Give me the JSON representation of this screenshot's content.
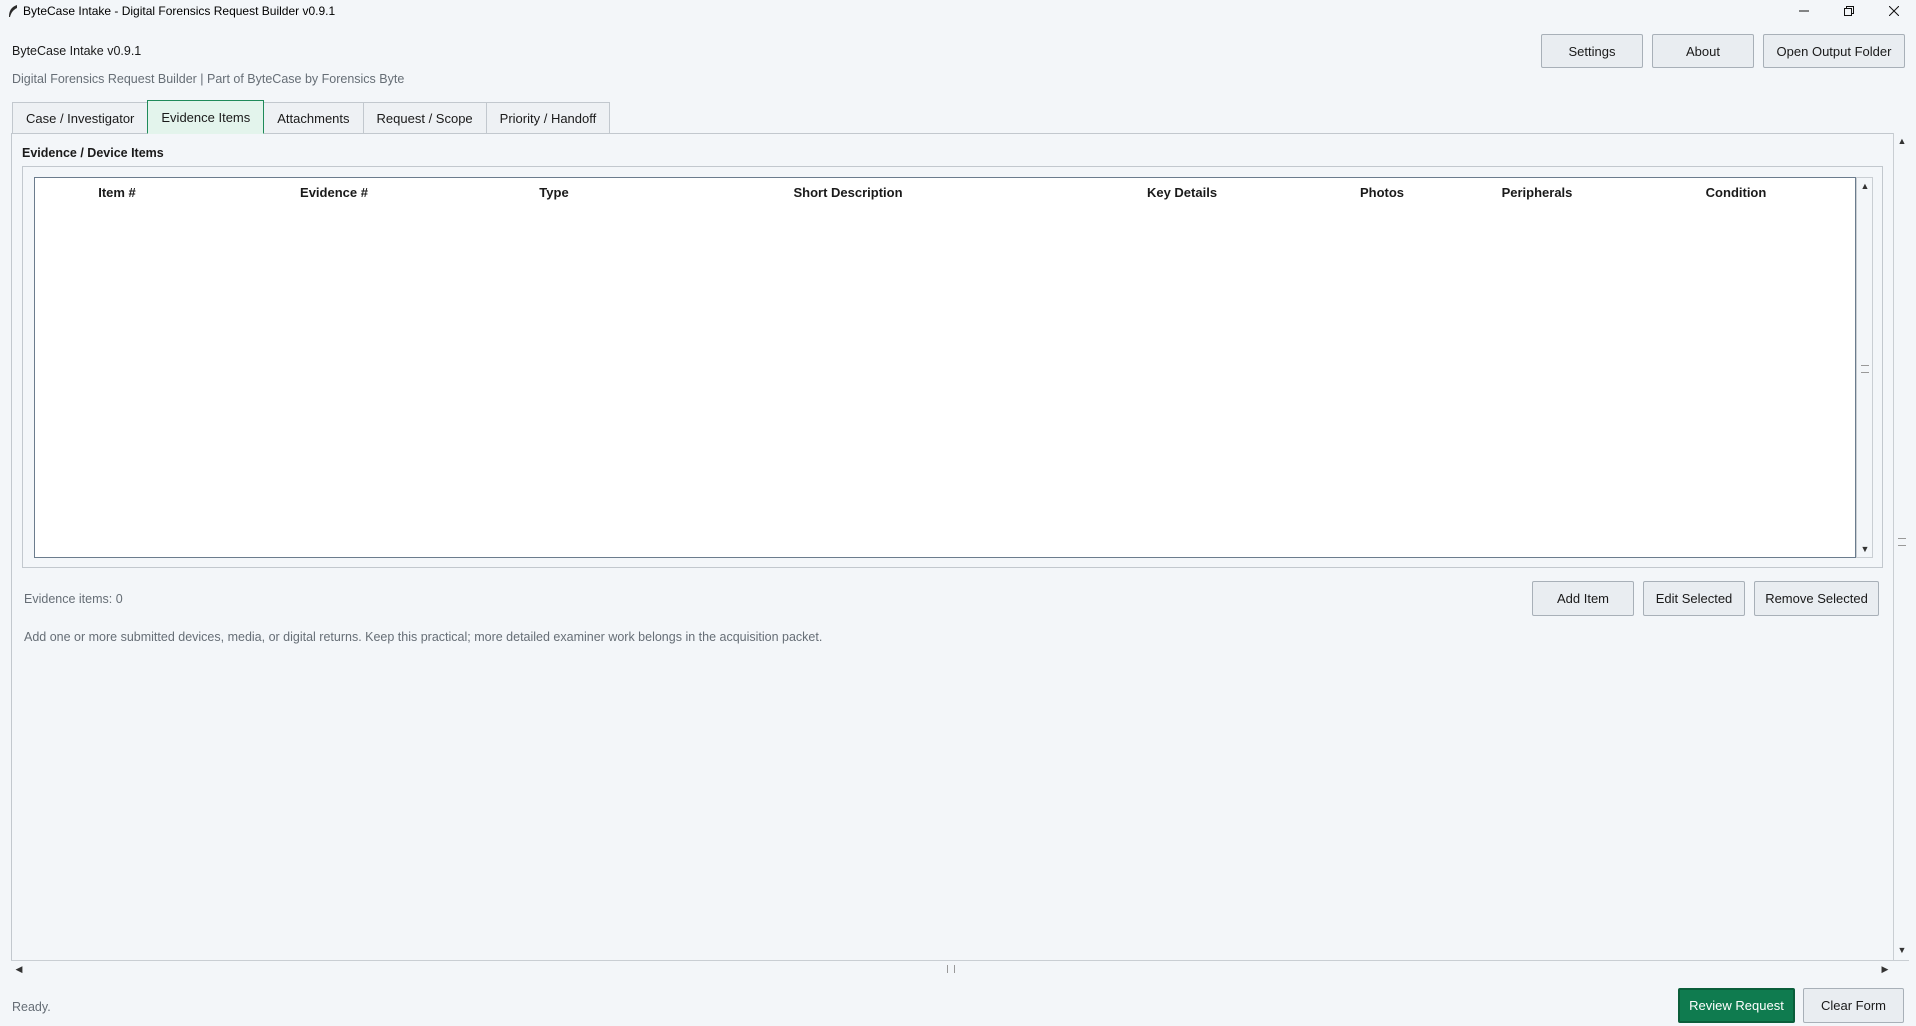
{
  "window": {
    "title": "ByteCase Intake - Digital Forensics Request Builder v0.9.1",
    "icon": "feather-icon"
  },
  "header": {
    "app_name": "ByteCase Intake v0.9.1",
    "subtitle": "Digital Forensics Request Builder | Part of ByteCase by Forensics Byte",
    "buttons": {
      "settings": "Settings",
      "about": "About",
      "open_output": "Open Output Folder"
    }
  },
  "tabs": [
    {
      "label": "Case / Investigator",
      "active": false
    },
    {
      "label": "Evidence Items",
      "active": true
    },
    {
      "label": "Attachments",
      "active": false
    },
    {
      "label": "Request / Scope",
      "active": false
    },
    {
      "label": "Priority / Handoff",
      "active": false
    }
  ],
  "evidence": {
    "group_title": "Evidence / Device Items",
    "columns": [
      "Item #",
      "Evidence #",
      "Type",
      "Short Description",
      "Key Details",
      "Photos",
      "Peripherals",
      "Condition"
    ],
    "rows": [],
    "count_text": "Evidence items: 0",
    "help_text": "Add one or more submitted devices, media, or digital returns. Keep this practical; more detailed examiner work belongs in the acquisition packet.",
    "buttons": {
      "add": "Add Item",
      "edit": "Edit Selected",
      "remove": "Remove Selected"
    }
  },
  "footer": {
    "status": "Ready.",
    "review": "Review Request",
    "clear": "Clear Form"
  },
  "colors": {
    "accent": "#0f7b4f",
    "active_tab_bg": "#e3f4ec",
    "background": "#f3f6f9"
  }
}
